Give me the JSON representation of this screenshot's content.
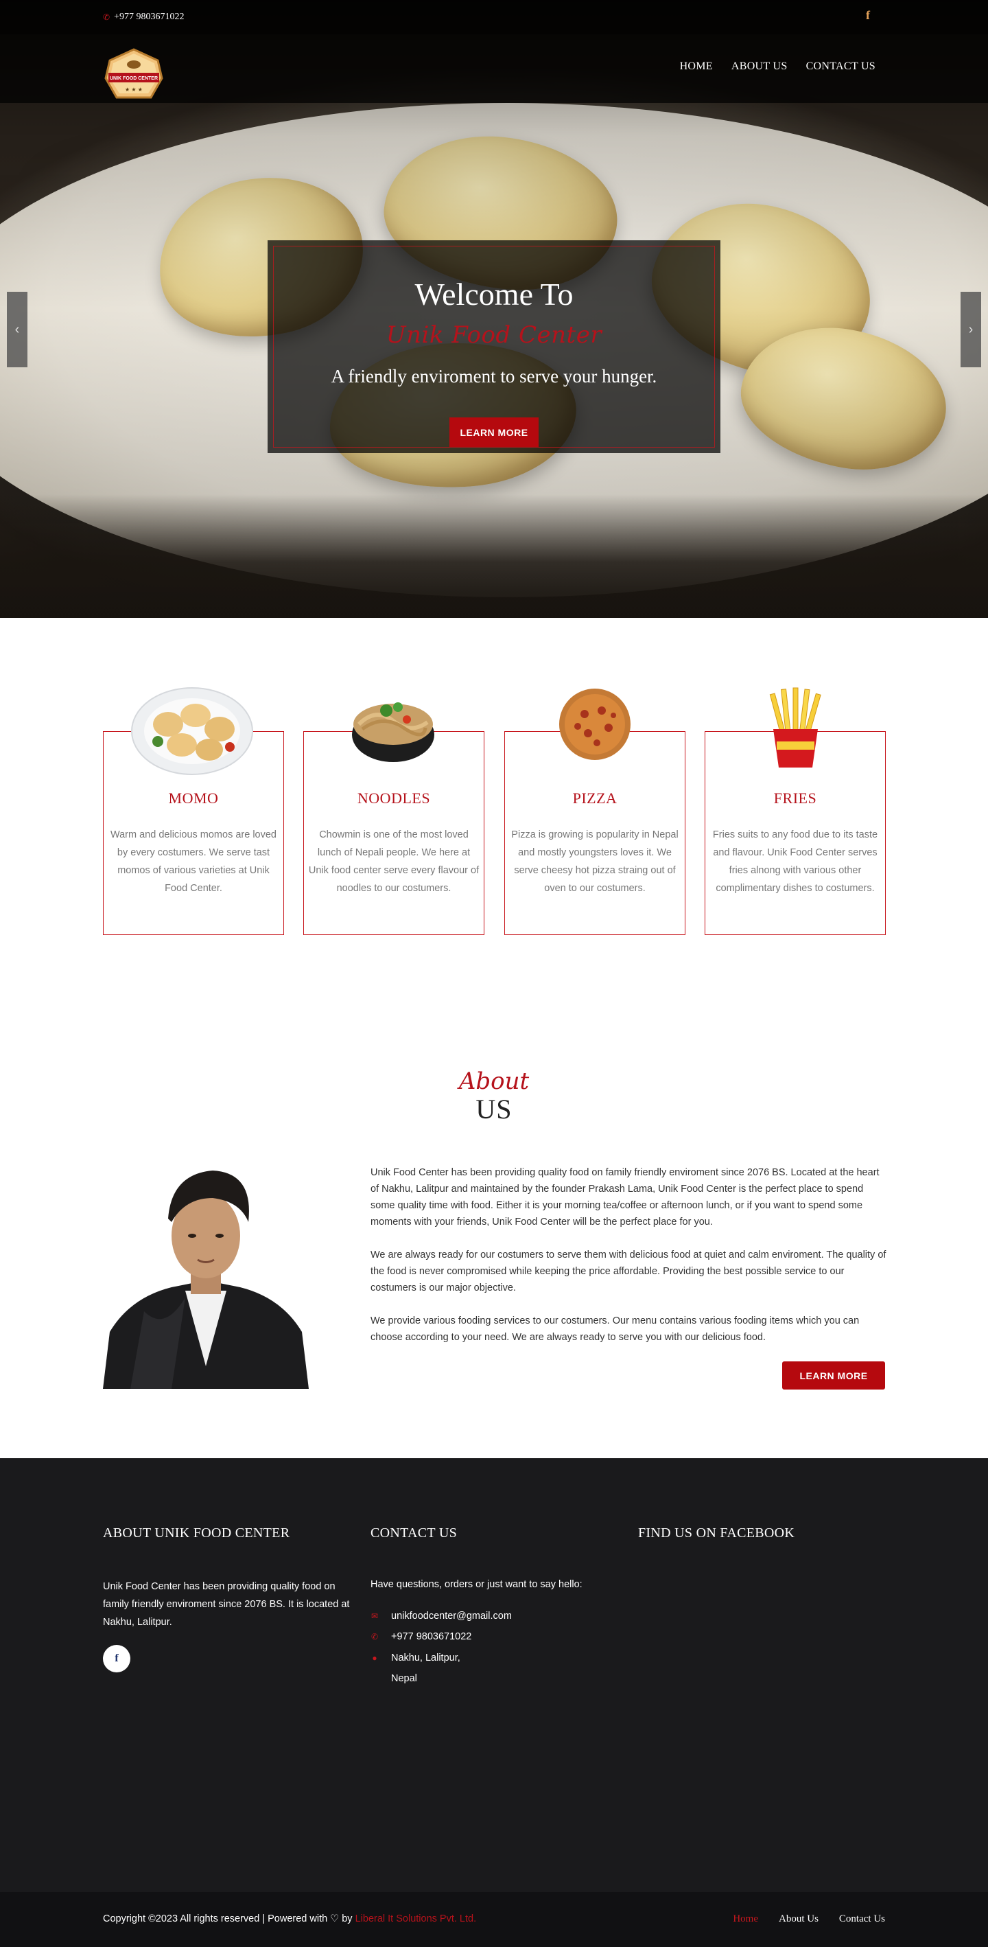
{
  "topbar": {
    "phone": "+977 9803671022",
    "facebook_icon": "facebook-icon"
  },
  "logo": {
    "text": "UNIK FOOD CENTER"
  },
  "nav": {
    "items": [
      "HOME",
      "ABOUT US",
      "CONTACT US"
    ]
  },
  "hero": {
    "title": "Welcome To",
    "script": "Unik Food Center",
    "tagline": "A friendly enviroment to serve your hunger.",
    "button": "LEARN MORE",
    "prev_icon": "chevron-left-icon",
    "next_icon": "chevron-right-icon"
  },
  "services": [
    {
      "title": "MOMO",
      "desc": "Warm and delicious momos are loved by every costumers. We serve tast momos of various varieties at Unik Food Center."
    },
    {
      "title": "NOODLES",
      "desc": "Chowmin is one of the most loved lunch of Nepali people. We here at Unik food center serve every flavour of noodles to our costumers."
    },
    {
      "title": "PIZZA",
      "desc": "Pizza is growing is popularity in Nepal and mostly youngsters loves it. We serve cheesy hot pizza straing out of oven to our costumers."
    },
    {
      "title": "FRIES",
      "desc": "Fries suits to any food due to its taste and flavour. Unik Food Center serves fries alnong with various other complimentary dishes to costumers."
    }
  ],
  "about": {
    "script": "About",
    "heading": "US",
    "p1": "Unik Food Center has been providing quality food on family friendly enviroment since 2076 BS. Located at the heart of Nakhu, Lalitpur and maintained by the founder Prakash Lama, Unik Food Center is the perfect place to spend some quality time with food. Either it is your morning tea/coffee or afternoon lunch, or if you want to spend some moments with your friends, Unik Food Center will be the perfect place for you.",
    "p2": "We are always ready for our costumers to serve them with delicious food at quiet and calm enviroment. The quality of the food is never compromised while keeping the price affordable. Providing the best possible service to our costumers is our major objective.",
    "p3": "We provide various fooding services to our costumers. Our menu contains various fooding items which you can choose according to your need. We are always ready to serve you with our delicious food.",
    "button": "LEARN MORE"
  },
  "footer": {
    "about_heading": "ABOUT UNIK FOOD CENTER",
    "about_text": "Unik Food Center has been providing quality food on family friendly enviroment since 2076 BS. It is located at Nakhu, Lalitpur.",
    "contact_heading": "CONTACT US",
    "contact_intro": "Have questions, orders or just want to say hello:",
    "email": "unikfoodcenter@gmail.com",
    "phone": "+977 9803671022",
    "address_line1": "Nakhu, Lalitpur,",
    "address_line2": "Nepal",
    "facebook_heading": "FIND US ON FACEBOOK"
  },
  "bottom": {
    "copyright_prefix": "Copyright ©2023 All rights reserved | Powered with",
    "by": "by",
    "company": "Liberal It Solutions Pvt. Ltd.",
    "links": [
      "Home",
      "About Us",
      "Contact Us"
    ]
  },
  "colors": {
    "accent": "#b5090e",
    "footer_bg": "#1a1a1c",
    "icon_gold": "#e7a45b"
  }
}
